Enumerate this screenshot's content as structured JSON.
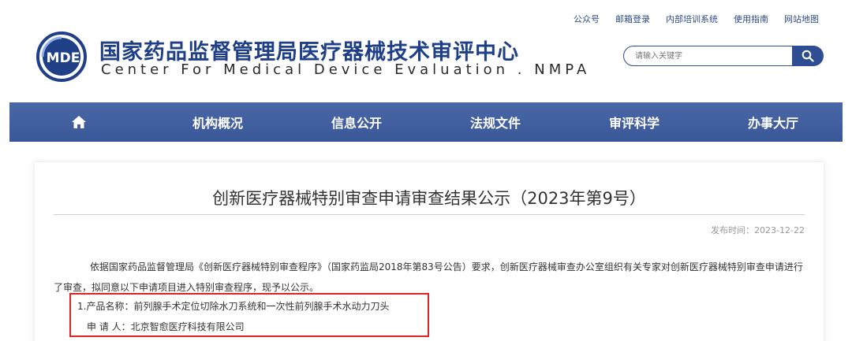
{
  "toplinks": [
    "公众号",
    "邮箱登录",
    "内部培训系统",
    "使用指南",
    "网站地图"
  ],
  "logo": {
    "text": "MDE"
  },
  "site": {
    "title": "国家药品监督管理局医疗器械技术审评中心",
    "subtitle": "Center For Medical Device Evaluation . NMPA"
  },
  "search": {
    "placeholder": "请输入关键字",
    "icon": "search-icon"
  },
  "nav": {
    "home_icon": "home-icon",
    "items": [
      "机构概况",
      "信息公开",
      "法规文件",
      "审评科学",
      "办事大厅"
    ]
  },
  "article": {
    "title": "创新医疗器械特别审查申请审查结果公示（2023年第9号）",
    "date_label": "发布时间：",
    "date": "2023-12-22",
    "paragraph": "依据国家药品监督管理局《创新医疗器械特别审查程序》（国家药监局2018年第83号公告）要求，创新医疗器械审查办公室组织有关专家对创新医疗器械特别审查申请进行了审查，拟同意以下申请项目进入特别审查程序，现予以公示。",
    "item1_name": "1.产品名称：前列腺手术定位切除水刀系统和一次性前列腺手术水动力刀头",
    "item1_applicant": "申 请 人：北京智愈医疗科技有限公司"
  },
  "colors": {
    "brand": "#1f3f87",
    "nav": "#3a5797",
    "highlight": "#e02424"
  }
}
